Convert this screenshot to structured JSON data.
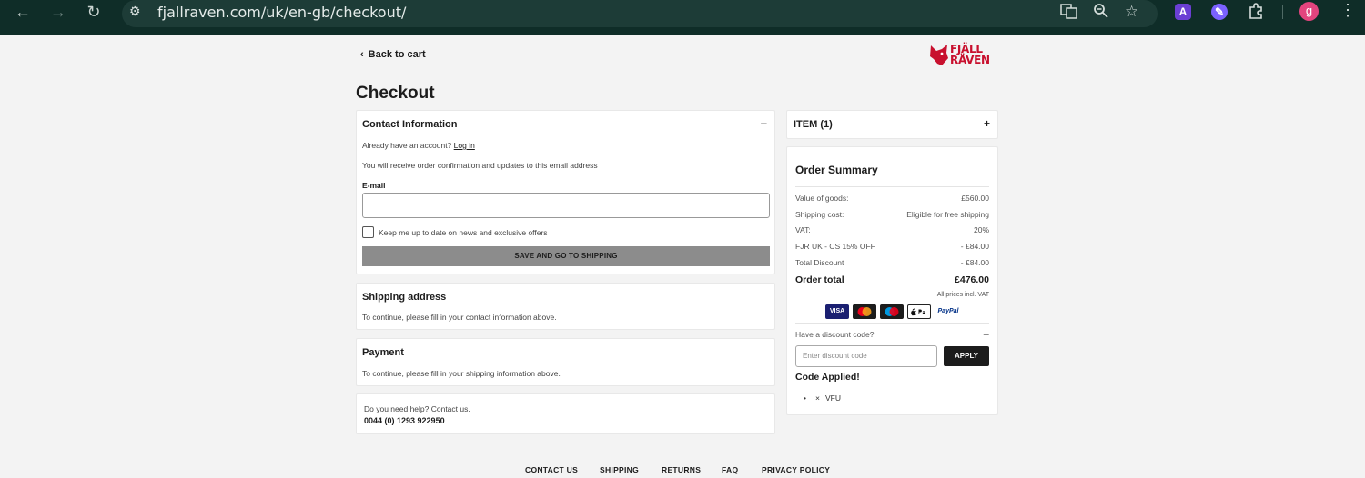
{
  "browser": {
    "url": "fjallraven.com/uk/en-gb/checkout/",
    "profile_initial": "g",
    "ext_a_label": "A"
  },
  "page": {
    "back_label": "Back to cart",
    "logo_line1": "FJÄLL",
    "logo_line2": "RÄVEN",
    "title": "Checkout"
  },
  "contact": {
    "heading": "Contact Information",
    "collapse_symbol": "–",
    "account_prompt": "Already have an account?",
    "login_label": "Log in",
    "email_note": "You will receive order confirmation and updates to this email address",
    "email_label": "E-mail",
    "email_value": "",
    "newsletter_label": "Keep me up to date on news and exclusive offers",
    "save_button": "SAVE AND GO TO SHIPPING"
  },
  "shipping": {
    "heading": "Shipping address",
    "note": "To continue, please fill in your contact information above."
  },
  "payment": {
    "heading": "Payment",
    "note": "To continue, please fill in your shipping information above."
  },
  "help": {
    "text": "Do you need help? Contact us.",
    "phone": "0044 (0) 1293 922950"
  },
  "items": {
    "label": "ITEM (1)",
    "expand_symbol": "+"
  },
  "summary": {
    "heading": "Order Summary",
    "rows": [
      {
        "label": "Value of goods:",
        "value": "£560.00"
      },
      {
        "label": "Shipping cost:",
        "value": "Eligible for free shipping"
      },
      {
        "label": "VAT:",
        "value": "20%"
      },
      {
        "label": "FJR UK - CS 15% OFF",
        "value": "- £84.00"
      },
      {
        "label": "Total Discount",
        "value": "- £84.00"
      }
    ],
    "total_label": "Order total",
    "total_value": "£476.00",
    "vat_note": "All prices incl. VAT",
    "payment_methods": [
      "VISA",
      "Mastercard",
      "Maestro",
      "Apple Pay",
      "PayPal"
    ],
    "discount_prompt": "Have a discount code?",
    "discount_toggle": "–",
    "discount_placeholder": "Enter discount code",
    "apply_label": "APPLY",
    "applied_heading": "Code Applied!",
    "applied_code": "VFU",
    "remove_symbol": "×"
  },
  "footer": {
    "links": [
      "CONTACT US",
      "SHIPPING",
      "RETURNS",
      "FAQ",
      "PRIVACY POLICY"
    ]
  },
  "colors": {
    "chrome": "#0f2d28",
    "brand_red": "#c8102e",
    "button_disabled": "#8c8c8c"
  }
}
